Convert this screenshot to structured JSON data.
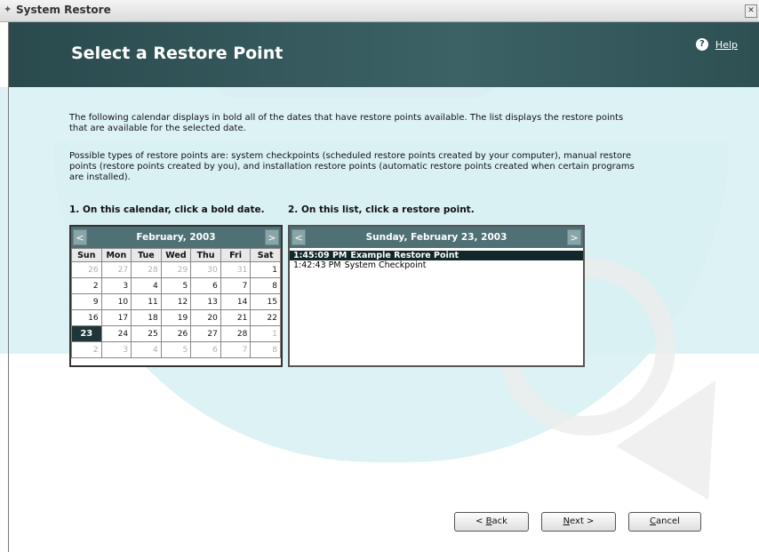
{
  "window": {
    "title": "System Restore"
  },
  "header": {
    "heading": "Select a Restore Point",
    "help_label": "Help"
  },
  "body": {
    "paragraph1": "The following calendar displays in bold all of the dates that have restore points available. The list displays the restore points that are available for the selected date.",
    "paragraph2": "Possible types of restore points are: system checkpoints (scheduled restore points created by your computer), manual restore points (restore points created by you), and installation restore points (automatic restore points created when certain programs are installed).",
    "step1": "1. On this calendar, click a bold date.",
    "step2": "2. On this list, click a restore point."
  },
  "calendar": {
    "month": "February, 2003",
    "prev": "<",
    "next": ">",
    "days": [
      "Sun",
      "Mon",
      "Tue",
      "Wed",
      "Thu",
      "Fri",
      "Sat"
    ],
    "weeks": [
      [
        {
          "d": "26",
          "o": true
        },
        {
          "d": "27",
          "o": true
        },
        {
          "d": "28",
          "o": true
        },
        {
          "d": "29",
          "o": true
        },
        {
          "d": "30",
          "o": true
        },
        {
          "d": "31",
          "o": true
        },
        {
          "d": "1"
        }
      ],
      [
        {
          "d": "2"
        },
        {
          "d": "3"
        },
        {
          "d": "4"
        },
        {
          "d": "5"
        },
        {
          "d": "6"
        },
        {
          "d": "7"
        },
        {
          "d": "8"
        }
      ],
      [
        {
          "d": "9"
        },
        {
          "d": "10"
        },
        {
          "d": "11"
        },
        {
          "d": "12"
        },
        {
          "d": "13"
        },
        {
          "d": "14"
        },
        {
          "d": "15"
        }
      ],
      [
        {
          "d": "16"
        },
        {
          "d": "17"
        },
        {
          "d": "18"
        },
        {
          "d": "19"
        },
        {
          "d": "20"
        },
        {
          "d": "21"
        },
        {
          "d": "22"
        }
      ],
      [
        {
          "d": "23",
          "s": true
        },
        {
          "d": "24"
        },
        {
          "d": "25"
        },
        {
          "d": "26"
        },
        {
          "d": "27"
        },
        {
          "d": "28"
        },
        {
          "d": "1",
          "o": true
        }
      ],
      [
        {
          "d": "2",
          "o": true
        },
        {
          "d": "3",
          "o": true
        },
        {
          "d": "4",
          "o": true
        },
        {
          "d": "5",
          "o": true
        },
        {
          "d": "6",
          "o": true
        },
        {
          "d": "7",
          "o": true
        },
        {
          "d": "8",
          "o": true
        }
      ]
    ]
  },
  "restore_list": {
    "date": "Sunday, February 23, 2003",
    "prev": "<",
    "next": ">",
    "items": [
      {
        "time": "1:45:09 PM",
        "name": "Example Restore Point",
        "selected": true
      },
      {
        "time": "1:42:43 PM",
        "name": "System Checkpoint",
        "selected": false
      }
    ]
  },
  "buttons": {
    "back": {
      "pre": "< ",
      "key": "B",
      "rest": "ack"
    },
    "next": {
      "pre": "",
      "key": "N",
      "rest": "ext >"
    },
    "cancel": {
      "pre": "",
      "key": "C",
      "rest": "ancel"
    }
  },
  "colors": {
    "header_bg": "#3c6266",
    "calendar_header": "#4f7175",
    "selection": "#12272a"
  }
}
